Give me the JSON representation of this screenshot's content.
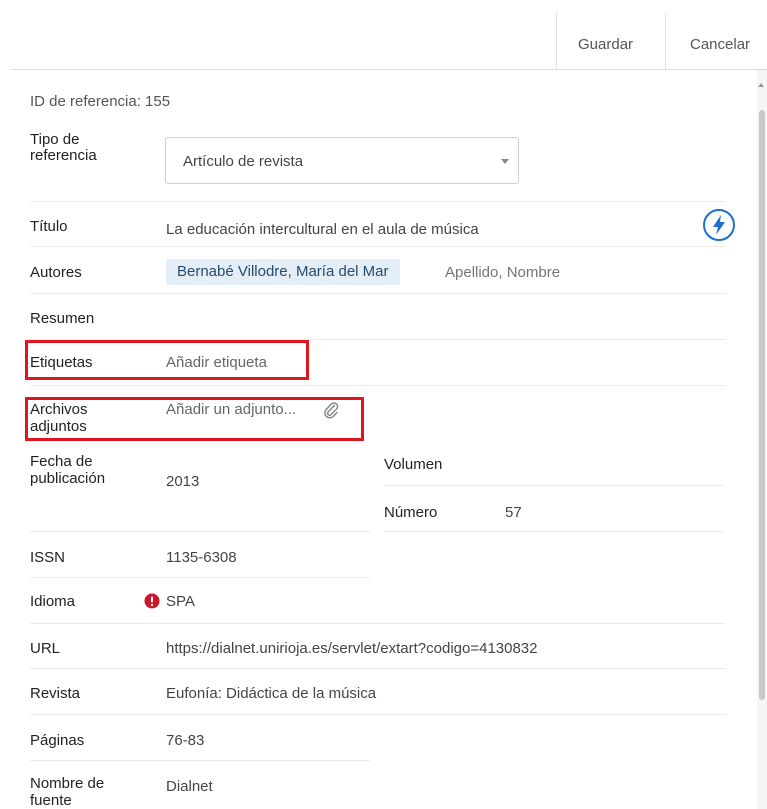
{
  "toolbar": {
    "save_label": "Guardar",
    "cancel_label": "Cancelar"
  },
  "reference": {
    "id_text": "ID de referencia: 155"
  },
  "fields": {
    "tipo": {
      "label_line1": "Tipo de",
      "label_line2": "referencia",
      "value": "Artículo de revista"
    },
    "titulo": {
      "label": "Título",
      "value": "La educación intercultural en el aula de música"
    },
    "autores": {
      "label": "Autores",
      "author_chip": "Bernabé Villodre, María del Mar",
      "input_placeholder": "Apellido, Nombre"
    },
    "resumen": {
      "label": "Resumen"
    },
    "etiquetas": {
      "label": "Etiquetas",
      "placeholder": "Añadir etiqueta"
    },
    "archivos": {
      "label_line1": "Archivos",
      "label_line2": "adjuntos",
      "placeholder": "Añadir un adjunto..."
    },
    "fecha": {
      "label_line1": "Fecha de",
      "label_line2": "publicación",
      "value": "2013"
    },
    "volumen": {
      "label": "Volumen",
      "value": ""
    },
    "numero": {
      "label": "Número",
      "value": "57"
    },
    "issn": {
      "label": "ISSN",
      "value": "1135-6308"
    },
    "idioma": {
      "label": "Idioma",
      "value": "SPA"
    },
    "url": {
      "label": "URL",
      "value": "https://dialnet.unirioja.es/servlet/extart?codigo=4130832"
    },
    "revista": {
      "label": "Revista",
      "value": "Eufonía: Didáctica de la música"
    },
    "paginas": {
      "label": "Páginas",
      "value": "76-83"
    },
    "fuente": {
      "label_line1": "Nombre de",
      "label_line2": "fuente",
      "value": "Dialnet"
    }
  },
  "icons": {
    "bolt": "lightning-bolt-icon",
    "clip": "paperclip-icon",
    "warn": "exclamation-circle-icon",
    "caret": "chevron-down-icon"
  },
  "colors": {
    "accent_blue": "#1a6fd1",
    "highlight_red": "#e0161f",
    "warning_red": "#c9182b",
    "chip_bg": "#e3eef9"
  }
}
